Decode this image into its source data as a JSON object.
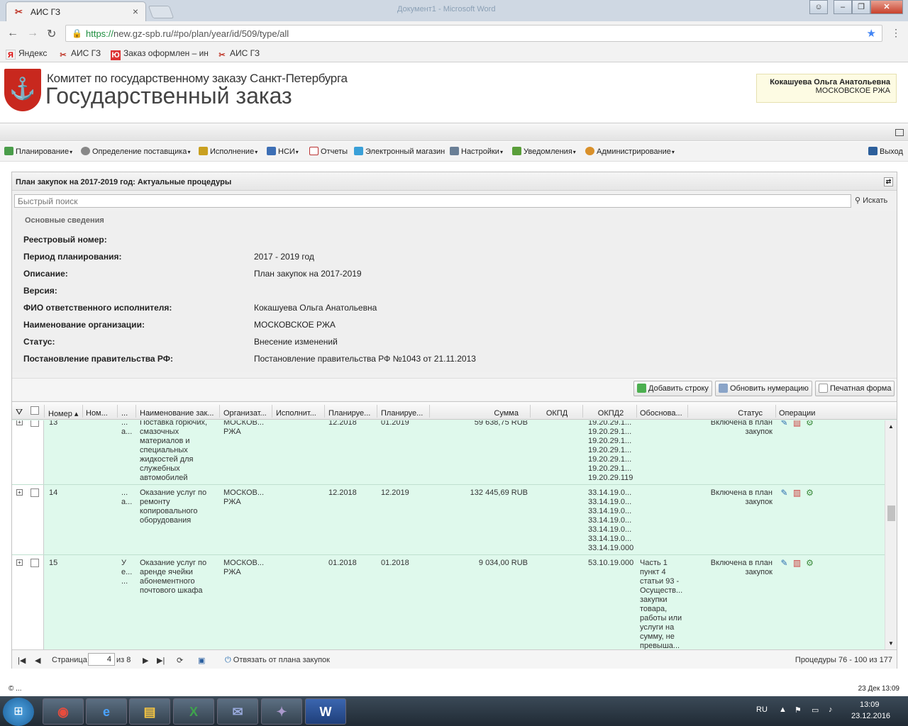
{
  "browser": {
    "tab_title": "АИС ГЗ",
    "window_title": "Документ1 - Microsoft Word",
    "url_secure": "https://",
    "url_rest": "new.gz-spb.ru/#po/plan/year/id/509/type/all",
    "bookmarks": [
      "Яндекс",
      "АИС ГЗ",
      "Заказ оформлен – ин",
      "АИС ГЗ"
    ]
  },
  "header": {
    "org_line1": "Комитет по государственному заказу Санкт-Петербурга",
    "org_line2": "Государственный заказ",
    "user_name": "Кокашуева Ольга Анатольевна",
    "user_org": "МОСКОВСКОЕ РЖА"
  },
  "menu": [
    "Планирование",
    "Определение поставщика",
    "Исполнение",
    "НСИ",
    "Отчеты",
    "Электронный магазин",
    "Настройки",
    "Уведомления",
    "Администрирование"
  ],
  "logout": "Выход",
  "panel": {
    "title": "План закупок на 2017-2019 год: Актуальные процедуры",
    "search_placeholder": "Быстрый поиск",
    "search_button": "Искать",
    "section": "Основные сведения",
    "fields": [
      {
        "label": "Реестровый номер:",
        "value": ""
      },
      {
        "label": "Период планирования:",
        "value": "2017 - 2019 год"
      },
      {
        "label": "Описание:",
        "value": "План закупок на 2017-2019"
      },
      {
        "label": "Версия:",
        "value": ""
      },
      {
        "label": "ФИО ответственного исполнителя:",
        "value": "Кокашуева Ольга Анатольевна"
      },
      {
        "label": "Наименование организации:",
        "value": "МОСКОВСКОЕ РЖА"
      },
      {
        "label": "Статус:",
        "value": "Внесение изменений"
      },
      {
        "label": "Постановление правительства РФ:",
        "value": "Постановление правительства РФ №1043 от 21.11.2013"
      }
    ],
    "buttons": [
      "Добавить строку",
      "Обновить нумерацию",
      "Печатная форма"
    ]
  },
  "grid": {
    "columns": [
      "Номер",
      "Ном...",
      "...",
      "Наименование зак...",
      "Организат...",
      "Исполнит...",
      "Планируе...",
      "Планируе...",
      "Сумма",
      "ОКПД",
      "ОКПД2",
      "Обоснова...",
      "Статус",
      "Операции"
    ],
    "rows": [
      {
        "num": "13",
        "col3": "...\nа...",
        "name": "Поставка горючих,\nсмазочных\nматериалов и\nспециальных\nжидкостей для\nслужебных\nавтомобилей",
        "org": "МОСКОВ...\nРЖА",
        "plan1": "12.2018",
        "plan2": "01.2019",
        "sum": "59 638,75 RUB",
        "okpd2": "19.20.29.1...\n19.20.29.1...\n19.20.29.1...\n19.20.29.1...\n19.20.29.1...\n19.20.29.1...\n19.20.29.119",
        "basis": "",
        "status": "Включена в план\nзакупок"
      },
      {
        "num": "14",
        "col3": "...\nа...",
        "name": "Оказание услуг по\nремонту\nкопировального\nоборудования",
        "org": "МОСКОВ...\nРЖА",
        "plan1": "12.2018",
        "plan2": "12.2019",
        "sum": "132 445,69 RUB",
        "okpd2": "33.14.19.0...\n33.14.19.0...\n33.14.19.0...\n33.14.19.0...\n33.14.19.0...\n33.14.19.0...\n33.14.19.000",
        "basis": "",
        "status": "Включена в план\nзакупок"
      },
      {
        "num": "15",
        "col3": "У\nе...\n...",
        "name": "Оказание услуг по\nаренде ячейки\nабонементного\nпочтового шкафа",
        "org": "МОСКОВ...\nРЖА",
        "plan1": "01.2018",
        "plan2": "01.2018",
        "sum": "9 034,00 RUB",
        "okpd2": "53.10.19.000",
        "basis": "Часть 1\nпункт 4\nстатьи 93 -\nОсуществ...\nзакупки\nтовара,\nработы или\nуслуги на\nсумму, не\nпревыша...",
        "status": "Включена в план\nзакупок"
      }
    ]
  },
  "pager": {
    "page_label": "Страница",
    "page": "4",
    "of": "из 8",
    "unbind": "Отвязать от плана закупок",
    "summary": "Процедуры 76 - 100 из 177"
  },
  "statusbar": {
    "left": "© ...",
    "right": "23 Дек 13:09"
  },
  "taskbar": {
    "lang": "RU",
    "time": "13:09",
    "date": "23.12.2016"
  }
}
